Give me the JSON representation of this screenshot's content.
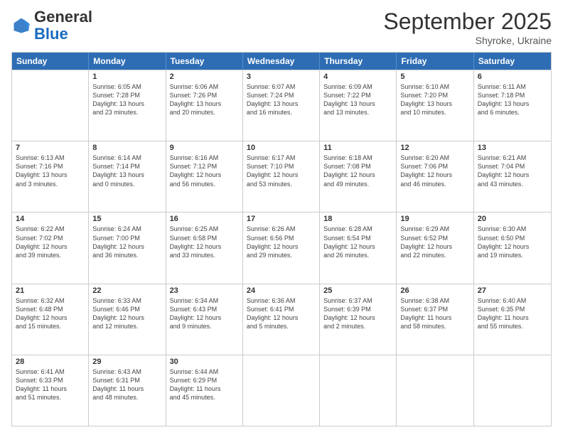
{
  "header": {
    "logo_general": "General",
    "logo_blue": "Blue",
    "month_title": "September 2025",
    "location": "Shyroke, Ukraine"
  },
  "weekdays": [
    "Sunday",
    "Monday",
    "Tuesday",
    "Wednesday",
    "Thursday",
    "Friday",
    "Saturday"
  ],
  "rows": [
    [
      {
        "day": "",
        "info": ""
      },
      {
        "day": "1",
        "info": "Sunrise: 6:05 AM\nSunset: 7:28 PM\nDaylight: 13 hours\nand 23 minutes."
      },
      {
        "day": "2",
        "info": "Sunrise: 6:06 AM\nSunset: 7:26 PM\nDaylight: 13 hours\nand 20 minutes."
      },
      {
        "day": "3",
        "info": "Sunrise: 6:07 AM\nSunset: 7:24 PM\nDaylight: 13 hours\nand 16 minutes."
      },
      {
        "day": "4",
        "info": "Sunrise: 6:09 AM\nSunset: 7:22 PM\nDaylight: 13 hours\nand 13 minutes."
      },
      {
        "day": "5",
        "info": "Sunrise: 6:10 AM\nSunset: 7:20 PM\nDaylight: 13 hours\nand 10 minutes."
      },
      {
        "day": "6",
        "info": "Sunrise: 6:11 AM\nSunset: 7:18 PM\nDaylight: 13 hours\nand 6 minutes."
      }
    ],
    [
      {
        "day": "7",
        "info": "Sunrise: 6:13 AM\nSunset: 7:16 PM\nDaylight: 13 hours\nand 3 minutes."
      },
      {
        "day": "8",
        "info": "Sunrise: 6:14 AM\nSunset: 7:14 PM\nDaylight: 13 hours\nand 0 minutes."
      },
      {
        "day": "9",
        "info": "Sunrise: 6:16 AM\nSunset: 7:12 PM\nDaylight: 12 hours\nand 56 minutes."
      },
      {
        "day": "10",
        "info": "Sunrise: 6:17 AM\nSunset: 7:10 PM\nDaylight: 12 hours\nand 53 minutes."
      },
      {
        "day": "11",
        "info": "Sunrise: 6:18 AM\nSunset: 7:08 PM\nDaylight: 12 hours\nand 49 minutes."
      },
      {
        "day": "12",
        "info": "Sunrise: 6:20 AM\nSunset: 7:06 PM\nDaylight: 12 hours\nand 46 minutes."
      },
      {
        "day": "13",
        "info": "Sunrise: 6:21 AM\nSunset: 7:04 PM\nDaylight: 12 hours\nand 43 minutes."
      }
    ],
    [
      {
        "day": "14",
        "info": "Sunrise: 6:22 AM\nSunset: 7:02 PM\nDaylight: 12 hours\nand 39 minutes."
      },
      {
        "day": "15",
        "info": "Sunrise: 6:24 AM\nSunset: 7:00 PM\nDaylight: 12 hours\nand 36 minutes."
      },
      {
        "day": "16",
        "info": "Sunrise: 6:25 AM\nSunset: 6:58 PM\nDaylight: 12 hours\nand 33 minutes."
      },
      {
        "day": "17",
        "info": "Sunrise: 6:26 AM\nSunset: 6:56 PM\nDaylight: 12 hours\nand 29 minutes."
      },
      {
        "day": "18",
        "info": "Sunrise: 6:28 AM\nSunset: 6:54 PM\nDaylight: 12 hours\nand 26 minutes."
      },
      {
        "day": "19",
        "info": "Sunrise: 6:29 AM\nSunset: 6:52 PM\nDaylight: 12 hours\nand 22 minutes."
      },
      {
        "day": "20",
        "info": "Sunrise: 6:30 AM\nSunset: 6:50 PM\nDaylight: 12 hours\nand 19 minutes."
      }
    ],
    [
      {
        "day": "21",
        "info": "Sunrise: 6:32 AM\nSunset: 6:48 PM\nDaylight: 12 hours\nand 15 minutes."
      },
      {
        "day": "22",
        "info": "Sunrise: 6:33 AM\nSunset: 6:46 PM\nDaylight: 12 hours\nand 12 minutes."
      },
      {
        "day": "23",
        "info": "Sunrise: 6:34 AM\nSunset: 6:43 PM\nDaylight: 12 hours\nand 9 minutes."
      },
      {
        "day": "24",
        "info": "Sunrise: 6:36 AM\nSunset: 6:41 PM\nDaylight: 12 hours\nand 5 minutes."
      },
      {
        "day": "25",
        "info": "Sunrise: 6:37 AM\nSunset: 6:39 PM\nDaylight: 12 hours\nand 2 minutes."
      },
      {
        "day": "26",
        "info": "Sunrise: 6:38 AM\nSunset: 6:37 PM\nDaylight: 11 hours\nand 58 minutes."
      },
      {
        "day": "27",
        "info": "Sunrise: 6:40 AM\nSunset: 6:35 PM\nDaylight: 11 hours\nand 55 minutes."
      }
    ],
    [
      {
        "day": "28",
        "info": "Sunrise: 6:41 AM\nSunset: 6:33 PM\nDaylight: 11 hours\nand 51 minutes."
      },
      {
        "day": "29",
        "info": "Sunrise: 6:43 AM\nSunset: 6:31 PM\nDaylight: 11 hours\nand 48 minutes."
      },
      {
        "day": "30",
        "info": "Sunrise: 6:44 AM\nSunset: 6:29 PM\nDaylight: 11 hours\nand 45 minutes."
      },
      {
        "day": "",
        "info": ""
      },
      {
        "day": "",
        "info": ""
      },
      {
        "day": "",
        "info": ""
      },
      {
        "day": "",
        "info": ""
      }
    ]
  ]
}
